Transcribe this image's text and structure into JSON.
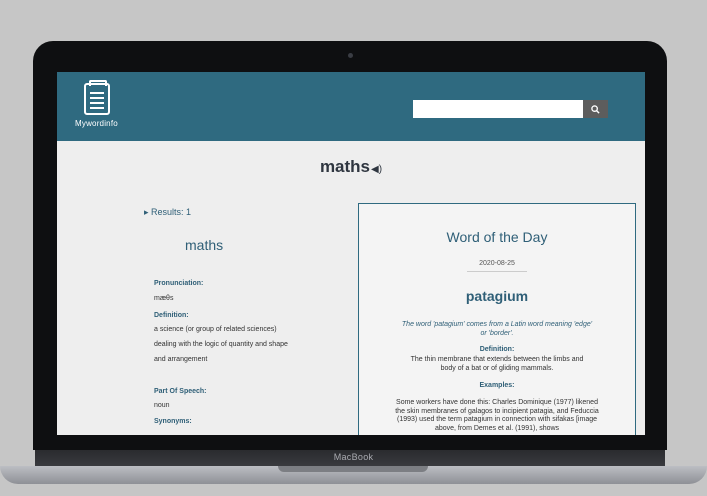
{
  "device": {
    "brand": "MacBook"
  },
  "header": {
    "logo_text": "Mywordinfo",
    "search_placeholder": "",
    "search_icon": "search-icon"
  },
  "word": {
    "title": "maths",
    "speaker_icon": "speaker-icon"
  },
  "results": {
    "label": "Results: 1",
    "word": "maths",
    "pronunciation_label": "Pronunciation:",
    "pronunciation": "mæθs",
    "definition_label": "Definition:",
    "definition": "a science (or group of related sciences) dealing with the logic of quantity and shape and arrangement",
    "pos_label": "Part Of Speech:",
    "pos": "noun",
    "synonyms_label": "Synonyms:"
  },
  "wotd": {
    "title": "Word of the Day",
    "date": "2020-08-25",
    "word": "patagium",
    "etymology": "The word 'patagium' comes from a Latin word meaning 'edge' or 'border'.",
    "definition_label": "Definition:",
    "definition": "The thin membrane that extends between the limbs and body of a bat or of gliding mammals.",
    "examples_label": "Examples:",
    "example": "Some workers have done this: Charles Dominique (1977) likened the skin membranes of galagos to incipient patagia, and Feduccia (1993) used the term patagium in connection with sifakas [image above, from Demes et al. (1991), shows"
  }
}
